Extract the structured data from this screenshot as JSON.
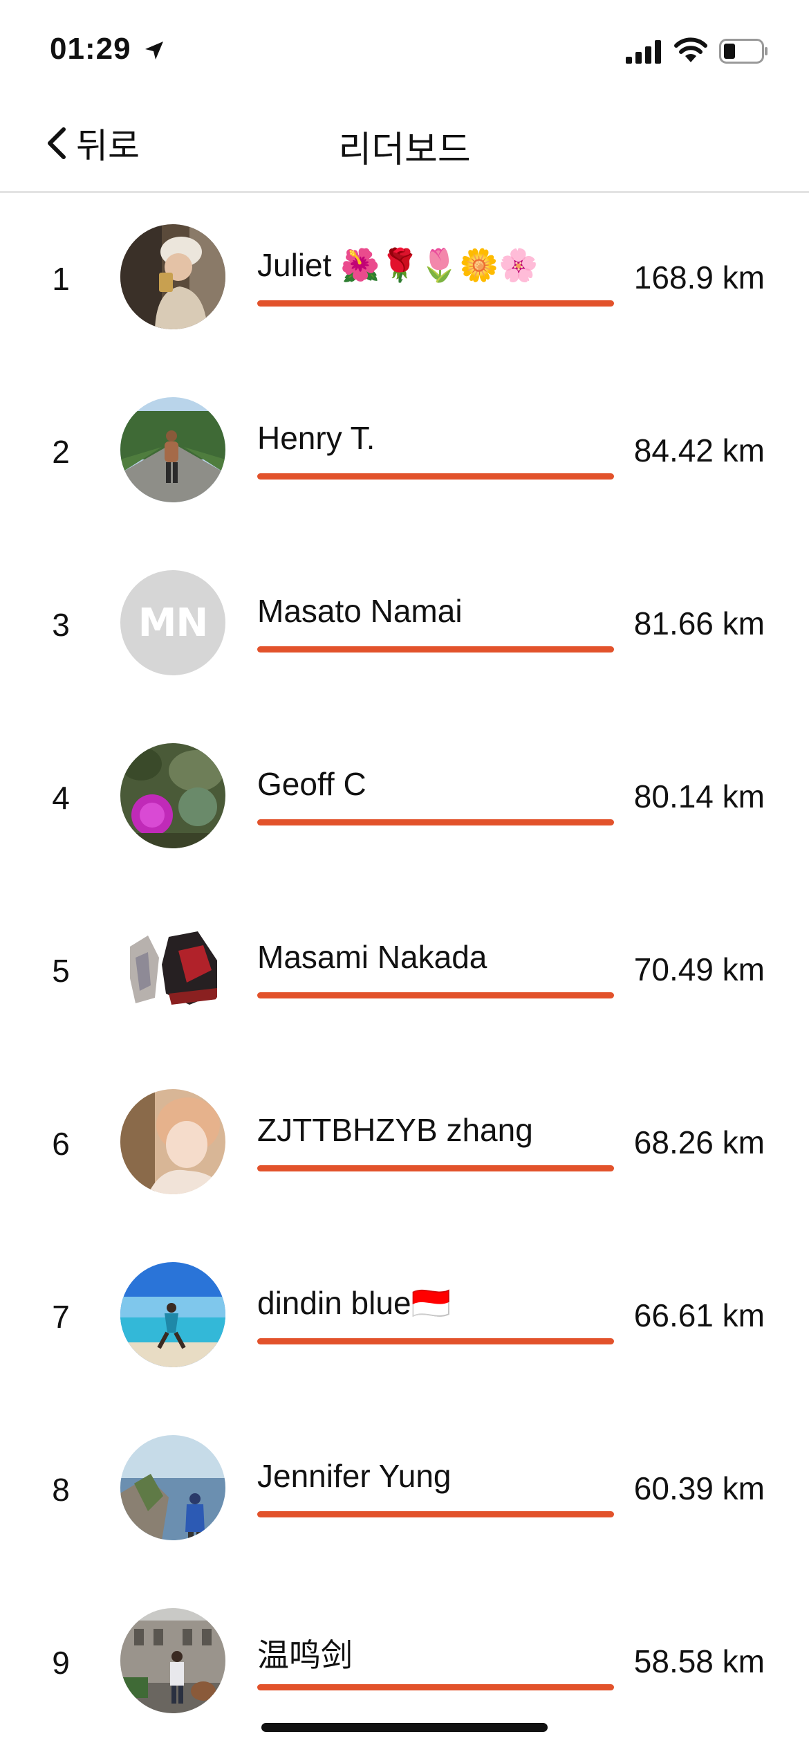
{
  "status_bar": {
    "time": "01:29"
  },
  "nav": {
    "back_label": "뒤로",
    "title": "리더보드"
  },
  "accent_color": "#e2522b",
  "leaderboard": [
    {
      "rank": "1",
      "name": "Juliet 🌺🌹🌷🌼🌸",
      "distance": "168.9 km",
      "progress": 1.0,
      "avatar": "photo-girl-selfie"
    },
    {
      "rank": "2",
      "name": "Henry T.",
      "distance": "84.42 km",
      "progress": 1.0,
      "avatar": "photo-runner-road"
    },
    {
      "rank": "3",
      "name": "Masato Namai",
      "distance": "81.66 km",
      "progress": 1.0,
      "avatar": "initials",
      "initials": "MN"
    },
    {
      "rank": "4",
      "name": "Geoff C",
      "distance": "80.14 km",
      "progress": 1.0,
      "avatar": "photo-thistle-flower"
    },
    {
      "rank": "5",
      "name": "Masami Nakada",
      "distance": "70.49 km",
      "progress": 1.0,
      "avatar": "photo-sneakers"
    },
    {
      "rank": "6",
      "name": "ZJTTBHZYB zhang",
      "distance": "68.26 km",
      "progress": 1.0,
      "avatar": "photo-portrait"
    },
    {
      "rank": "7",
      "name": "dindin blue🇮🇩",
      "distance": "66.61 km",
      "progress": 1.0,
      "avatar": "photo-beach"
    },
    {
      "rank": "8",
      "name": "Jennifer Yung",
      "distance": "60.39 km",
      "progress": 1.0,
      "avatar": "photo-coast-hiker"
    },
    {
      "rank": "9",
      "name": "温鸣剑",
      "distance": "58.58 km",
      "progress": 1.0,
      "avatar": "photo-building-person"
    }
  ]
}
